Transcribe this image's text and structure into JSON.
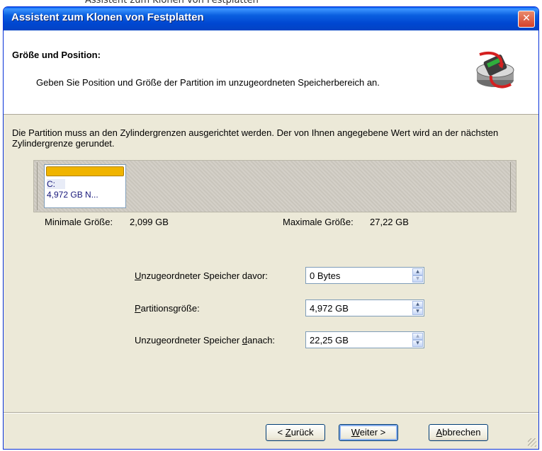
{
  "window": {
    "title": "Assistent zum Klonen von Festplatten",
    "close_symbol": "✕"
  },
  "header": {
    "title": "Größe und Position:",
    "subtitle": "Geben Sie Position und Größe der Partition im unzugeordneten Speicherbereich an.",
    "icon": "disk-clone-wizard-icon"
  },
  "info_text": "Die Partition muss an den Zylindergrenzen ausgerichtet werden. Der von Ihnen angegebene Wert wird an der nächsten Zylindergrenze gerundet.",
  "disk_map": {
    "partition_letter": "C:",
    "partition_size": "4,972 GB  N...",
    "stripe_color": "#f0b400"
  },
  "sizes": {
    "min_label": "Minimale Größe:",
    "min_value": "2,099 GB",
    "max_label": "Maximale Größe:",
    "max_value": "27,22 GB"
  },
  "fields": {
    "before": {
      "label_pre": "",
      "label_key": "U",
      "label_post": "nzugeordneter Speicher davor:",
      "value": "0 Bytes"
    },
    "size": {
      "label_pre": "",
      "label_key": "P",
      "label_post": "artitionsgröße:",
      "value": "4,972 GB"
    },
    "after": {
      "label_pre": "Unzugeordneter Speicher ",
      "label_key": "d",
      "label_post": "anach:",
      "value": "22,25 GB"
    }
  },
  "buttons": {
    "back_pre": "< ",
    "back_key": "Z",
    "back_post": "urück",
    "next_key": "W",
    "next_post": "eiter >",
    "cancel_key": "A",
    "cancel_post": "bbrechen"
  }
}
